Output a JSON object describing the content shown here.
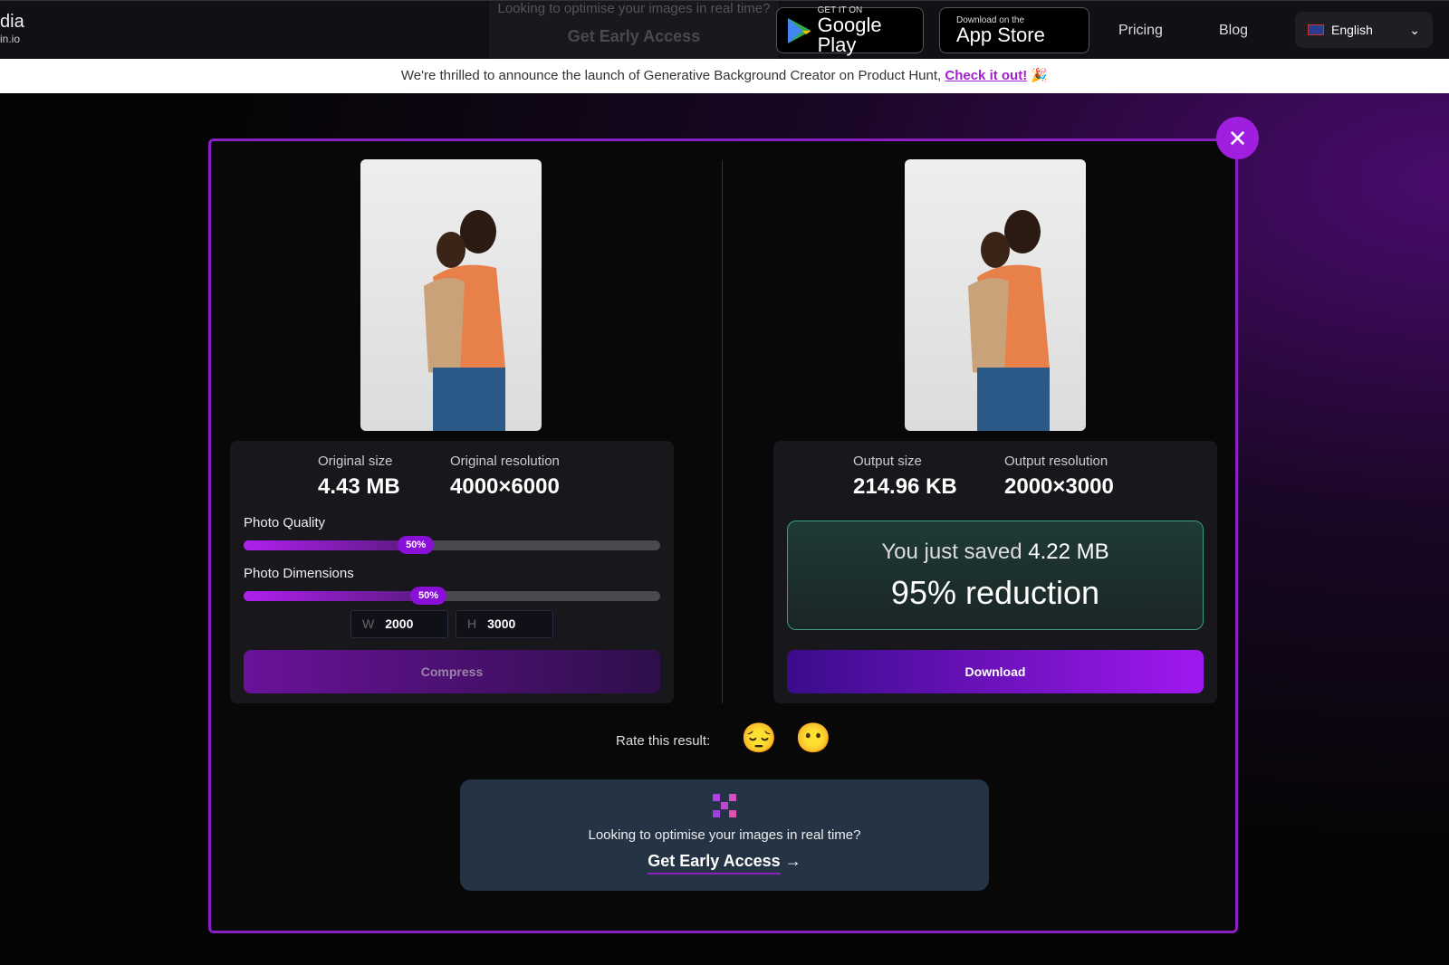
{
  "header": {
    "logo_text": "dia",
    "logo_sub": "in.io",
    "ghost_text": "Looking to optimise your images in real time?",
    "ghost_cta": "Get Early Access",
    "google_play_small": "GET IT ON",
    "google_play_large": "Google Play",
    "app_store_small": "Download on the",
    "app_store_large": "App Store",
    "nav": [
      "Pricing",
      "Blog"
    ],
    "language": "English"
  },
  "banner": {
    "text": "We're thrilled to announce the launch of Generative Background Creator on Product Hunt, ",
    "link": "Check it out!",
    "emoji": "🎉"
  },
  "original": {
    "size_label": "Original size",
    "size": "4.43 MB",
    "res_label": "Original resolution",
    "res": "4000×6000",
    "quality_label": "Photo Quality",
    "quality_value": "50%",
    "quality": 50,
    "dimensions_label": "Photo Dimensions",
    "dimensions_value": "50%",
    "dimensions": 50,
    "width_prefix": "W",
    "width": "2000",
    "height_prefix": "H",
    "height": "3000",
    "compress_label": "Compress"
  },
  "output": {
    "size_label": "Output size",
    "size": "214.96 KB",
    "res_label": "Output resolution",
    "res": "2000×3000",
    "saved_prefix": "You just saved",
    "saved_value": "4.22 MB",
    "reduction": "95% reduction",
    "download_label": "Download"
  },
  "rating": {
    "label": "Rate this result:",
    "options": [
      "😔",
      "😶"
    ]
  },
  "promo": {
    "text": "Looking to optimise your images in real time?",
    "cta": "Get Early Access",
    "arrow": "→"
  },
  "colors": {
    "accent": "#a01ee0",
    "border": "#8a1fc4"
  }
}
